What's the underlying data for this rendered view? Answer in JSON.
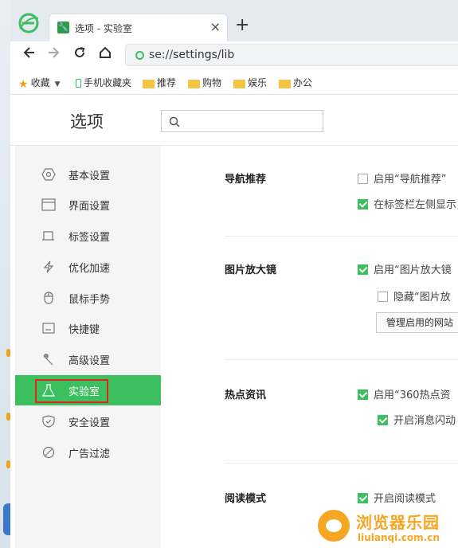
{
  "browser": {
    "tab_title": "选项 - 实验室",
    "tab_close": "×",
    "new_tab": "+",
    "url_scheme": "se://",
    "url_path": "settings/lib"
  },
  "bookmarks": [
    {
      "icon": "star-icon",
      "label": "收藏"
    },
    {
      "icon": "phone-icon",
      "label": "手机收藏夹"
    },
    {
      "icon": "folder-icon",
      "label": "推荐"
    },
    {
      "icon": "folder-icon",
      "label": "购物"
    },
    {
      "icon": "folder-icon",
      "label": "娱乐"
    },
    {
      "icon": "folder-icon",
      "label": "办公"
    }
  ],
  "page": {
    "title": "选项",
    "search_placeholder": ""
  },
  "sidebar": {
    "items": [
      {
        "label": "基本设置",
        "icon": "hexagon-icon"
      },
      {
        "label": "界面设置",
        "icon": "window-icon"
      },
      {
        "label": "标签设置",
        "icon": "tab-icon"
      },
      {
        "label": "优化加速",
        "icon": "lightning-icon"
      },
      {
        "label": "鼠标手势",
        "icon": "mouse-icon"
      },
      {
        "label": "快捷键",
        "icon": "keyboard-icon"
      },
      {
        "label": "高级设置",
        "icon": "wrench-icon"
      },
      {
        "label": "实验室",
        "icon": "flask-icon",
        "active": true
      },
      {
        "label": "安全设置",
        "icon": "shield-icon"
      },
      {
        "label": "广告过滤",
        "icon": "block-icon"
      }
    ]
  },
  "sections": {
    "nav": {
      "title": "导航推荐",
      "opt1": "启用“导航推荐”",
      "opt2": "在标签栏左侧显示"
    },
    "zoom": {
      "title": "图片放大镜",
      "opt1": "启用“图片放大镜",
      "opt2": "隐藏“图片放",
      "button": "管理启用的网站"
    },
    "hot": {
      "title": "热点资讯",
      "opt1": "启用“360热点资",
      "opt2": "开启消息闪动"
    },
    "read": {
      "title": "阅读模式",
      "opt1": "开启阅读模式"
    }
  },
  "watermark": {
    "title": "浏览器乐园",
    "url": "liulanqi.com.cn"
  },
  "colors": {
    "accent": "#3cbf5e",
    "highlight": "#e0261b",
    "watermark": "#f5a623"
  }
}
